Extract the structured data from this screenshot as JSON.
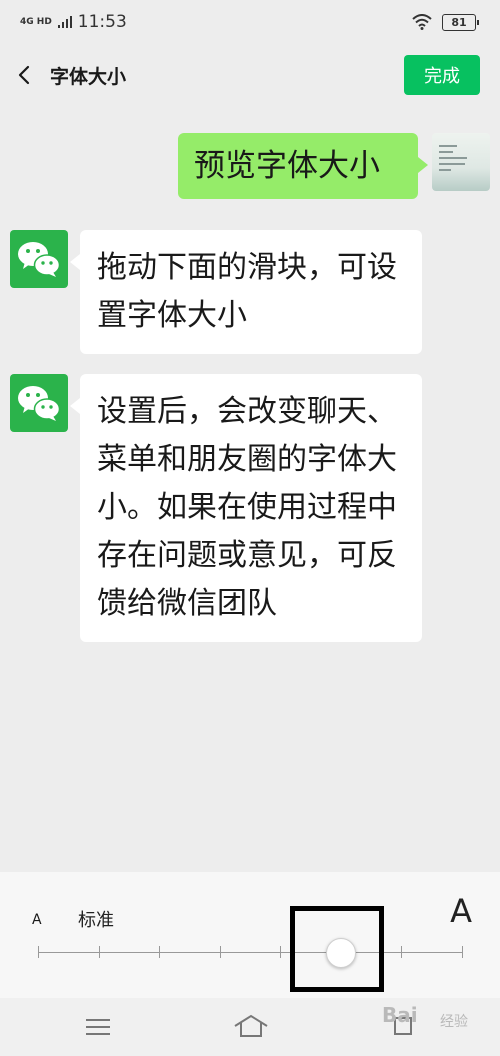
{
  "status": {
    "network": "4G HD",
    "time": "11:53",
    "battery": "81"
  },
  "header": {
    "title": "字体大小",
    "done_label": "完成"
  },
  "messages": {
    "outgoing": "预览字体大小",
    "incoming_1": "拖动下面的滑块，可设置字体大小",
    "incoming_2": "设置后，会改变聊天、菜单和朋友圈的字体大小。如果在使用过程中存在问题或意见，可反馈给微信团队"
  },
  "font_panel": {
    "small_a": "A",
    "current_label": "标准",
    "big_a": "A",
    "levels": 8,
    "selected_level_index": 5
  },
  "watermark": {
    "text": "Bai",
    "text_cn": "经验"
  },
  "colors": {
    "accent": "#07c160",
    "outgoing_bubble": "#95ec69",
    "wechat_avatar": "#2bb34b"
  }
}
